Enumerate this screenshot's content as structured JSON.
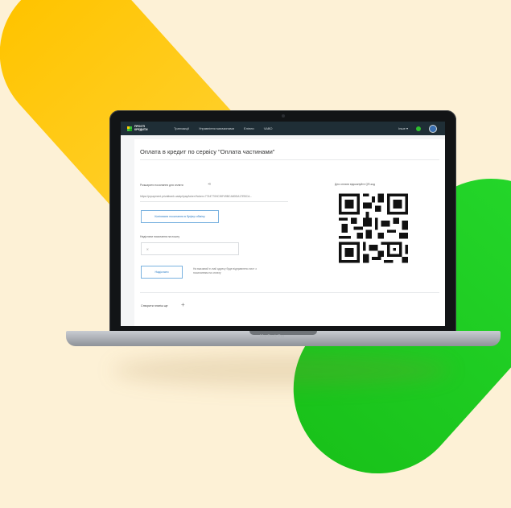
{
  "header": {
    "logo_line1": "ПРОСТІ",
    "logo_line2": "КРЕДИТИ",
    "nav": [
      "Транзакції",
      "Управління магазинами",
      "Еліпли",
      "ЧАВО"
    ],
    "user": "Іншe"
  },
  "page": {
    "title": "Оплата в кредит по сервісу \"Оплата частинами\"",
    "share_label": "Розшарити посилання для оплати",
    "link": "https://prpayment.privatbank.ua/api/pay/token?token=7744770HCWF49BCA80DA17EBCA...",
    "copy_button": "Копіювати посилання в буфер обміну",
    "email_label": "Надіслати посилання на пошту",
    "email_placeholder": "X",
    "send_button": "Надіслати",
    "send_hint": "На вказаний е-mail адресу буде відправлено лист з посиланням на оплату",
    "qr_label": "Для оплати відскануйте QR-код",
    "create_more": "Створити платіж ще"
  },
  "laptop": {
    "model": "MacBook Pro"
  },
  "colors": {
    "yellow": "#ffc400",
    "green": "#19c21a",
    "accent": "#2d7fc8",
    "header_bg": "#1f2e36"
  }
}
